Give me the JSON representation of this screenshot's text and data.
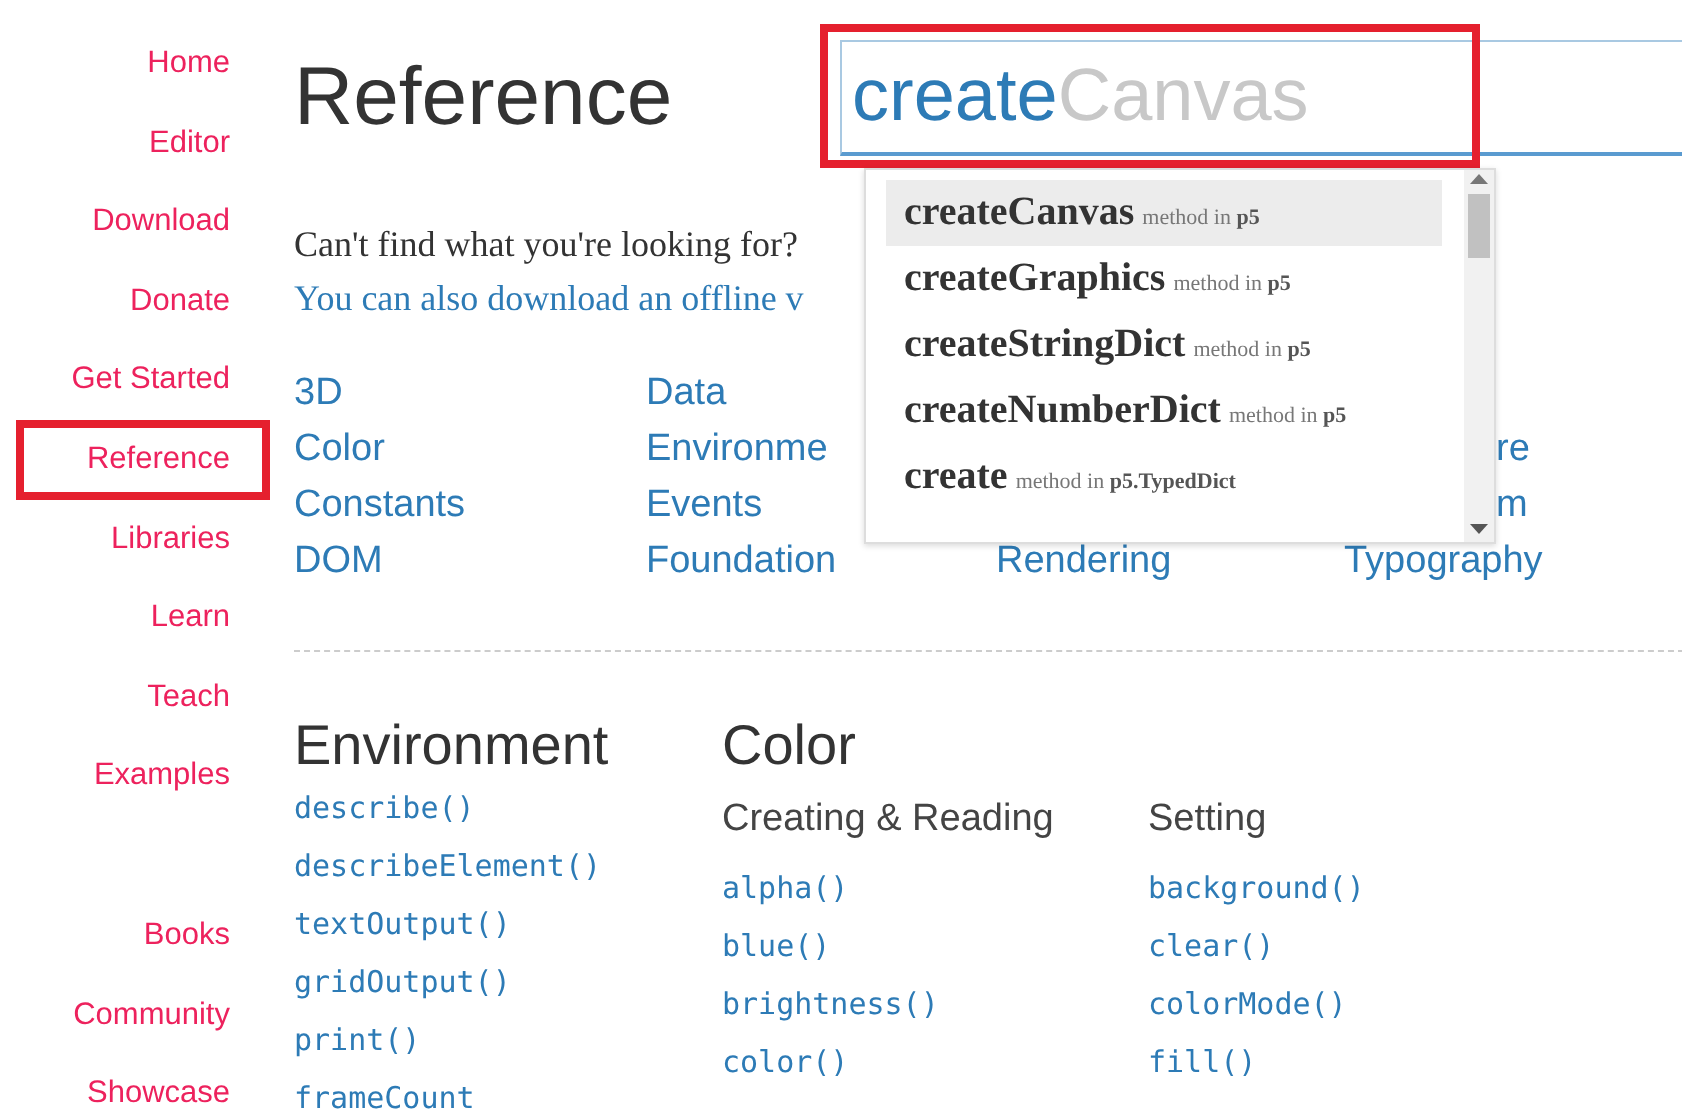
{
  "sidebar": {
    "groups": [
      {
        "items": [
          {
            "label": "Home",
            "highlighted": false
          },
          {
            "label": "Editor",
            "highlighted": false
          },
          {
            "label": "Download",
            "highlighted": false
          },
          {
            "label": "Donate",
            "highlighted": false
          },
          {
            "label": "Get Started",
            "highlighted": false
          },
          {
            "label": "Reference",
            "highlighted": true
          },
          {
            "label": "Libraries",
            "highlighted": false
          },
          {
            "label": "Learn",
            "highlighted": false
          },
          {
            "label": "Teach",
            "highlighted": false
          },
          {
            "label": "Examples",
            "highlighted": false
          }
        ]
      },
      {
        "items": [
          {
            "label": "Books",
            "highlighted": false
          },
          {
            "label": "Community",
            "highlighted": false
          },
          {
            "label": "Showcase",
            "highlighted": false
          }
        ]
      }
    ]
  },
  "header": {
    "title": "Reference",
    "search": {
      "value": "create",
      "completion": "Canvas",
      "highlighted": true
    },
    "suggestions": [
      {
        "name": "createCanvas",
        "detail": "method in **p5**",
        "selected": true
      },
      {
        "name": "createGraphics",
        "detail": "method in **p5**",
        "selected": false
      },
      {
        "name": "createStringDict",
        "detail": "method in **p5**",
        "selected": false
      },
      {
        "name": "createNumberDict",
        "detail": "method in **p5**",
        "selected": false
      },
      {
        "name": "create",
        "detail": "method in **p5.TypedDict**",
        "selected": false
      }
    ]
  },
  "intro": {
    "question": "Can't find what you're looking for?",
    "link": "You can also download an offline v"
  },
  "categories": {
    "columns": [
      {
        "items": [
          {
            "label": "3D",
            "kind": "link"
          },
          {
            "label": "Color",
            "kind": "link"
          },
          {
            "label": "Constants",
            "kind": "link"
          },
          {
            "label": "DOM",
            "kind": "link"
          }
        ]
      },
      {
        "items": [
          {
            "label": "Data",
            "kind": "link"
          },
          {
            "label": "Environme",
            "kind": "link"
          },
          {
            "label": "Events",
            "kind": "link"
          },
          {
            "label": "Foundation",
            "kind": "link"
          }
        ]
      },
      {
        "items": [
          {
            "label": "Rendering",
            "kind": "link"
          }
        ]
      },
      {
        "items": [
          {
            "label": "re",
            "kind": "fragment"
          },
          {
            "label": "m",
            "kind": "fragment"
          },
          {
            "label": "Typography",
            "kind": "link"
          }
        ]
      }
    ]
  },
  "sections": [
    {
      "title": "Environment",
      "groups": [
        {
          "items": [
            "describe()",
            "describeElement()",
            "textOutput()",
            "gridOutput()",
            "print()",
            "frameCount"
          ]
        }
      ]
    },
    {
      "title": "Color",
      "groups": [
        {
          "heading": "Creating & Reading",
          "items": [
            "alpha()",
            "blue()",
            "brightness()",
            "color()"
          ]
        },
        {
          "heading": "Setting",
          "items": [
            "background()",
            "clear()",
            "colorMode()",
            "fill()"
          ]
        }
      ]
    }
  ]
}
